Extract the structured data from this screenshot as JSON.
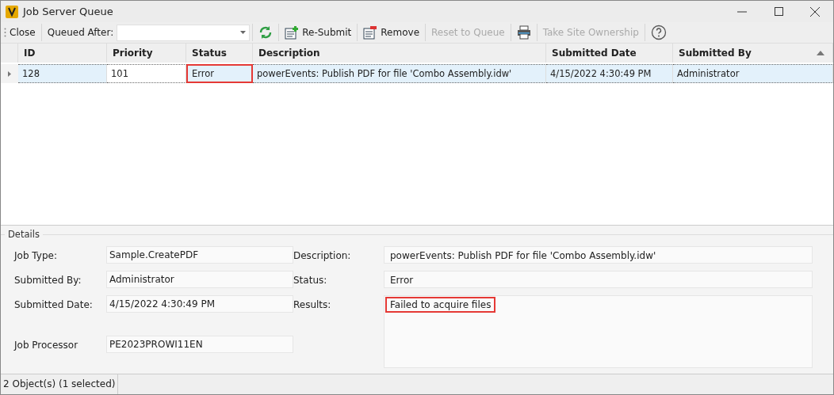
{
  "window": {
    "title": "Job Server Queue"
  },
  "toolbar": [
    {
      "kind": "button",
      "label": "Close",
      "disabled": false
    },
    {
      "kind": "combo",
      "label": "Queued After:"
    },
    {
      "kind": "refresh",
      "disabled": false
    },
    {
      "kind": "add",
      "label": "Re-Submit",
      "disabled": false
    },
    {
      "kind": "remove",
      "label": "Remove",
      "disabled": false
    },
    {
      "kind": "button",
      "label": "Reset to Queue",
      "disabled": true
    },
    {
      "kind": "print",
      "disabled": false
    },
    {
      "kind": "button",
      "label": "Take Site Ownership",
      "disabled": true
    },
    {
      "kind": "help",
      "disabled": false
    }
  ],
  "table": {
    "columns": [
      {
        "label": "ID",
        "sorted": false
      },
      {
        "label": "Priority",
        "sorted": false
      },
      {
        "label": "Status",
        "sorted": false
      },
      {
        "label": "Description",
        "sorted": false
      },
      {
        "label": "Submitted Date",
        "sorted": false
      },
      {
        "label": "Submitted By",
        "sorted": true
      }
    ],
    "rows": [
      {
        "selected": true,
        "cells": [
          {
            "text": "128",
            "highlighted": false
          },
          {
            "text": "101",
            "highlighted": false
          },
          {
            "text": "Error",
            "highlighted": true
          },
          {
            "text": "powerEvents: Publish PDF for file 'Combo Assembly.idw'",
            "highlighted": false
          },
          {
            "text": "4/15/2022 4:30:49 PM",
            "highlighted": false
          },
          {
            "text": "Administrator",
            "highlighted": false
          }
        ]
      }
    ]
  },
  "details": {
    "title": "Details",
    "left": [
      {
        "label": "Job Type:",
        "value": "Sample.CreatePDF"
      },
      {
        "label": "Submitted By:",
        "value": "Administrator"
      },
      {
        "label": "Submitted Date:",
        "value": "4/15/2022 4:30:49 PM"
      },
      {
        "label": "Job Processor",
        "value": "PE2023PROWI11EN"
      }
    ],
    "right": [
      {
        "label": "Description:",
        "value": "powerEvents: Publish PDF for file 'Combo Assembly.idw'",
        "multiline": false,
        "highlighted": false
      },
      {
        "label": "Status:",
        "value": "Error",
        "multiline": false,
        "highlighted": false
      },
      {
        "label": "Results:",
        "value": "Failed to acquire files",
        "multiline": true,
        "highlighted": true
      }
    ]
  },
  "status_bar": "2 Object(s) (1 selected)"
}
